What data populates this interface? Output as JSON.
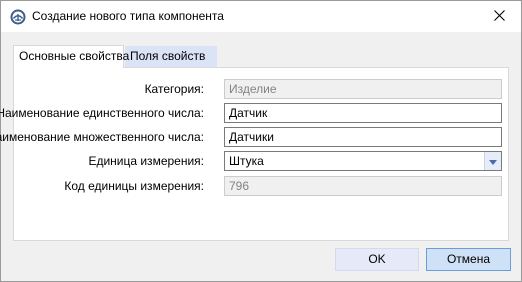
{
  "window": {
    "title": "Создание нового типа компонента",
    "app_icon": "app-emblem-icon",
    "close_icon": "close-icon"
  },
  "tabs": [
    {
      "label": "Основные свойства",
      "active": true
    },
    {
      "label": "Поля свойств",
      "active": false
    }
  ],
  "form": {
    "category": {
      "label": "Категория:",
      "value": "Изделие",
      "disabled": true
    },
    "singular_name": {
      "label": "Наименование единственного числа:",
      "value": "Датчик"
    },
    "plural_name": {
      "label": "Наименование множественного числа:",
      "value": "Датчики"
    },
    "unit": {
      "label": "Единица измерения:",
      "value": "Штука",
      "dropdown_icon": "chevron-down-icon"
    },
    "unit_code": {
      "label": "Код единицы измерения:",
      "value": "796",
      "disabled": true
    }
  },
  "buttons": {
    "ok": "OK",
    "cancel": "Отмена"
  },
  "colors": {
    "tab_inactive_bg": "#dbe3f6",
    "button_default_bg": "#cfe1f7",
    "button_default_border": "#6a9ed8"
  }
}
